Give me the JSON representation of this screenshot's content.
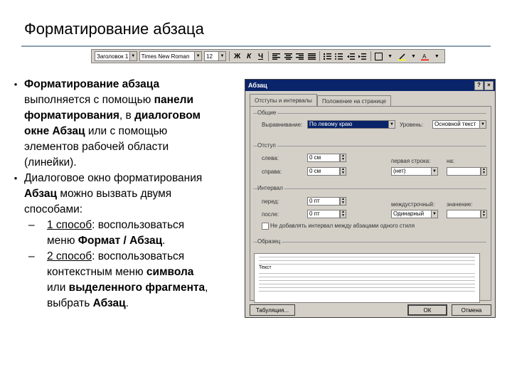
{
  "slide": {
    "title": "Форматирование абзаца"
  },
  "toolbar": {
    "style": "Заголовок 1",
    "font": "Times New Roman",
    "size": "12",
    "bold": "Ж",
    "italic": "К",
    "underline": "Ч"
  },
  "body": {
    "b1_title": "Форматирование абзаца",
    "b1_l2a": "выполняется с помощью ",
    "b1_l2b": "панели",
    "b1_l3a": "форматирования",
    "b1_l3b": ", в ",
    "b1_l3c": "диалоговом",
    "b1_l4": "окне Абзац",
    "b1_l4b": " или с помощью",
    "b1_l5": "элементов рабочей области",
    "b1_l6": "(линейки).",
    "b2_l1": " Диалоговое окно форматирования",
    "b2_l2a": "Абзац",
    "b2_l2b": "  можно вызвать двумя",
    "b2_l3": "способами:",
    "s1_a": "1 способ",
    "s1_b": ":  воспользоваться",
    "s1_c": "меню ",
    "s1_d": "Формат / Абзац",
    "s1_e": ".",
    "s2_a": "2 способ",
    "s2_b": ": воспользоваться",
    "s2_c": "контекстным меню ",
    "s2_d": "символа",
    "s2_e": "или ",
    "s2_f": "выделенного фрагмента",
    "s2_g": ",",
    "s2_h": "выбрать ",
    "s2_i": "Абзац",
    "s2_j": "."
  },
  "dialog": {
    "title": "Абзац",
    "help": "?",
    "close": "×",
    "tab1": "Отступы и интервалы",
    "tab2": "Положение на странице",
    "general": "Общие",
    "align_label": "Выравнивание:",
    "align_value": "По левому краю",
    "level_label": "Уровень:",
    "level_value": "Основной текст",
    "indent": "Отступ",
    "left_label": "слева:",
    "left_value": "0 см",
    "right_label": "справа:",
    "right_value": "0 см",
    "first_label": "первая строка:",
    "first_by": "на:",
    "first_value": "(нет)",
    "spacing": "Интервал",
    "before_label": "перед:",
    "before_value": "0 пт",
    "after_label": "после:",
    "after_value": "0 пт",
    "line_label": "междустрочный:",
    "line_by": "значение:",
    "line_value": "Одинарный",
    "no_space": "Не добавлять интервал между абзацами одного стиля",
    "sample": "Образец",
    "sample_word": "Текст",
    "tabs_btn": "Табуляция...",
    "ok_btn": "ОК",
    "cancel_btn": "Отмена"
  }
}
